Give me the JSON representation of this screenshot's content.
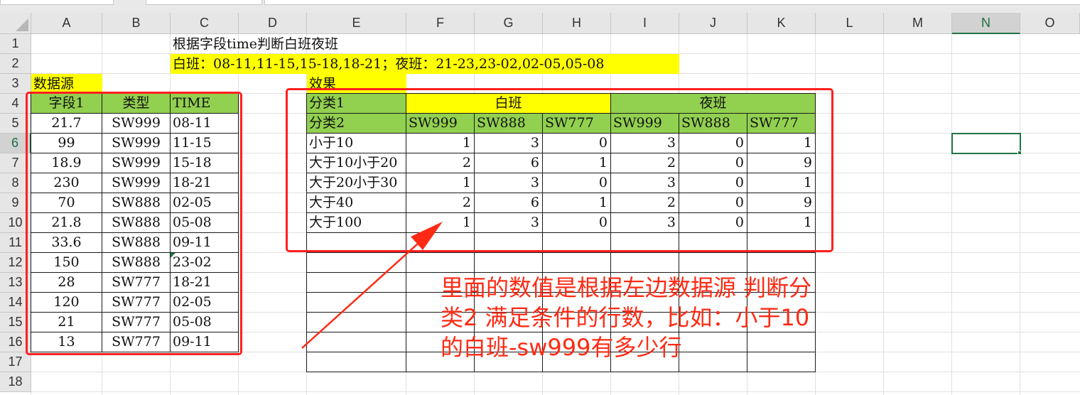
{
  "columns": [
    "A",
    "B",
    "C",
    "D",
    "E",
    "F",
    "G",
    "H",
    "I",
    "J",
    "K",
    "L",
    "M",
    "N",
    "O"
  ],
  "rows": [
    "1",
    "2",
    "3",
    "4",
    "5",
    "6",
    "7",
    "8",
    "9",
    "10",
    "11",
    "12",
    "13",
    "14",
    "15",
    "16",
    "17",
    "18"
  ],
  "selected_cell": {
    "col": "N",
    "row": "6"
  },
  "colors": {
    "yellow": "#ffff00",
    "green": "#92d050",
    "annotation_red": "#ff2a14",
    "selection_green": "#217346"
  },
  "header": {
    "title": "根据字段time判断白班夜班",
    "shift_def": "白班：08-11,11-15,15-18,18-21；夜班：21-23,23-02,02-05,05-08"
  },
  "source": {
    "label": "数据源",
    "headers": [
      "字段1",
      "类型",
      "TIME"
    ],
    "rows": [
      [
        "21.7",
        "SW999",
        "08-11"
      ],
      [
        "99",
        "SW999",
        "11-15"
      ],
      [
        "18.9",
        "SW999",
        "15-18"
      ],
      [
        "230",
        "SW999",
        "18-21"
      ],
      [
        "70",
        "SW888",
        "02-05"
      ],
      [
        "21.8",
        "SW888",
        "05-08"
      ],
      [
        "33.6",
        "SW888",
        "09-11"
      ],
      [
        "150",
        "SW888",
        "23-02"
      ],
      [
        "28",
        "SW777",
        "18-21"
      ],
      [
        "120",
        "SW777",
        "02-05"
      ],
      [
        "21",
        "SW777",
        "05-08"
      ],
      [
        "13",
        "SW777",
        "09-11"
      ]
    ]
  },
  "result": {
    "label": "效果",
    "cat1_label": "分类1",
    "cat2_label": "分类2",
    "day_label": "白班",
    "night_label": "夜班",
    "types": [
      "SW999",
      "SW888",
      "SW777",
      "SW999",
      "SW888",
      "SW777"
    ],
    "rows": [
      {
        "label": "小于10",
        "values": [
          "1",
          "3",
          "0",
          "3",
          "0",
          "1"
        ]
      },
      {
        "label": "大于10小于20",
        "values": [
          "2",
          "6",
          "1",
          "2",
          "0",
          "9"
        ]
      },
      {
        "label": "大于20小于30",
        "values": [
          "1",
          "3",
          "0",
          "3",
          "0",
          "1"
        ]
      },
      {
        "label": "大于40",
        "values": [
          "2",
          "6",
          "1",
          "2",
          "0",
          "9"
        ]
      },
      {
        "label": "大于100",
        "values": [
          "1",
          "3",
          "0",
          "3",
          "0",
          "1"
        ]
      }
    ]
  },
  "annotation": {
    "lines": [
      "里面的数值是根据左边数据源 判断分",
      "类2 满足条件的行数，比如：小于10",
      "的白班-sw999有多少行"
    ]
  }
}
